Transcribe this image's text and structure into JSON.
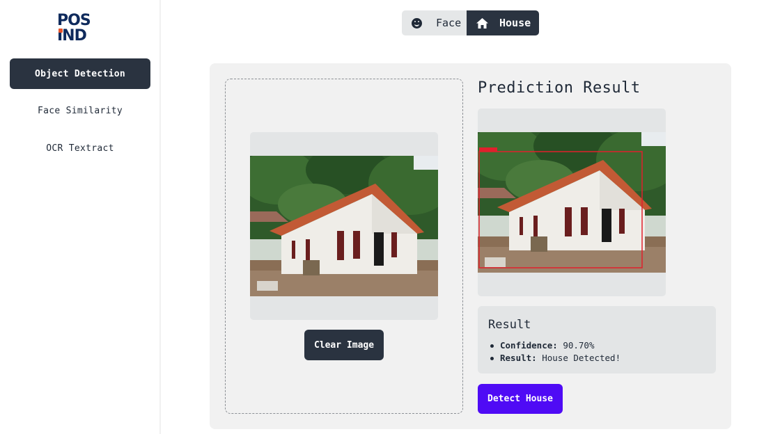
{
  "logo": {
    "line1": "POS",
    "line2": "IND"
  },
  "sidebar": {
    "items": [
      {
        "label": "Object Detection",
        "active": true
      },
      {
        "label": "Face Similarity",
        "active": false
      },
      {
        "label": "OCR Textract",
        "active": false
      }
    ]
  },
  "toggle": {
    "face_label": "Face",
    "house_label": "House",
    "selected": "House"
  },
  "upload": {
    "clear_label": "Clear Image"
  },
  "prediction": {
    "title": "Prediction Result",
    "result_title": "Result",
    "confidence_key": "Confidence:",
    "confidence_value": "90.70%",
    "result_key": "Result:",
    "result_value": "House Detected!",
    "detect_label": "Detect House"
  },
  "colors": {
    "sidebar_active": "#2a3340",
    "detect_button": "#4f0bf5",
    "panel_bg": "#f1f1f1",
    "bbox": "#e0202c"
  }
}
